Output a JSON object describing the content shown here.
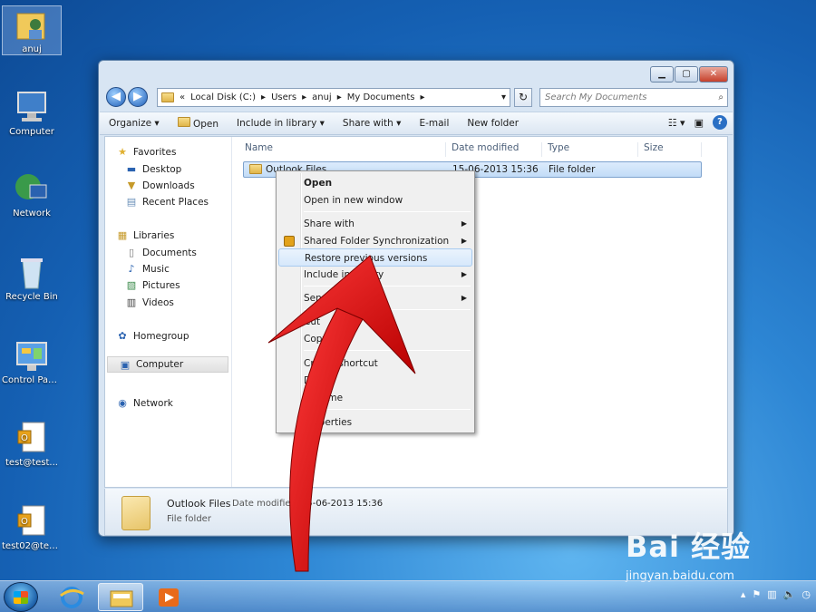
{
  "desktop": {
    "icons": [
      {
        "label": "anuj"
      },
      {
        "label": "Computer"
      },
      {
        "label": "Network"
      },
      {
        "label": "Recycle Bin"
      },
      {
        "label": "Control Panel"
      },
      {
        "label": "test@test..."
      },
      {
        "label": "test02@test..."
      }
    ]
  },
  "window": {
    "controls": {
      "minimize": "▁",
      "maximize": "▢",
      "close": "✕"
    },
    "address": {
      "prefix": "«",
      "crumbs": [
        "Local Disk (C:)",
        "Users",
        "anuj",
        "My Documents"
      ],
      "sep": "▸",
      "dropdown": "▾"
    },
    "search_placeholder": "Search My Documents",
    "toolbar": {
      "organize": "Organize ▾",
      "open": "Open",
      "include": "Include in library ▾",
      "share": "Share with ▾",
      "email": "E-mail",
      "newfolder": "New folder"
    },
    "nav": {
      "favorites": "Favorites",
      "desktop": "Desktop",
      "downloads": "Downloads",
      "recent": "Recent Places",
      "libraries": "Libraries",
      "documents": "Documents",
      "music": "Music",
      "pictures": "Pictures",
      "videos": "Videos",
      "homegroup": "Homegroup",
      "computer": "Computer",
      "network": "Network"
    },
    "columns": {
      "name": "Name",
      "date": "Date modified",
      "type": "Type",
      "size": "Size"
    },
    "row": {
      "name": "Outlook Files",
      "date": "15-06-2013 15:36",
      "type": "File folder"
    },
    "details": {
      "name": "Outlook Files",
      "date_label": "Date modified:",
      "date": "15-06-2013 15:36",
      "type": "File folder"
    }
  },
  "context_menu": {
    "open": "Open",
    "open_new": "Open in new window",
    "share_with": "Share with",
    "shared_sync": "Shared Folder Synchronization",
    "restore": "Restore previous versions",
    "include": "Include in library",
    "send_to": "Send to",
    "cut": "Cut",
    "copy": "Copy",
    "create_shortcut": "Create shortcut",
    "delete": "Delete",
    "rename": "Rename",
    "properties": "Properties"
  },
  "watermark": {
    "brand": "Bai 经验",
    "url": "jingyan.baidu.com"
  },
  "colors": {
    "accent_arrow": "#e01515",
    "selection": "#c2dcf7"
  }
}
